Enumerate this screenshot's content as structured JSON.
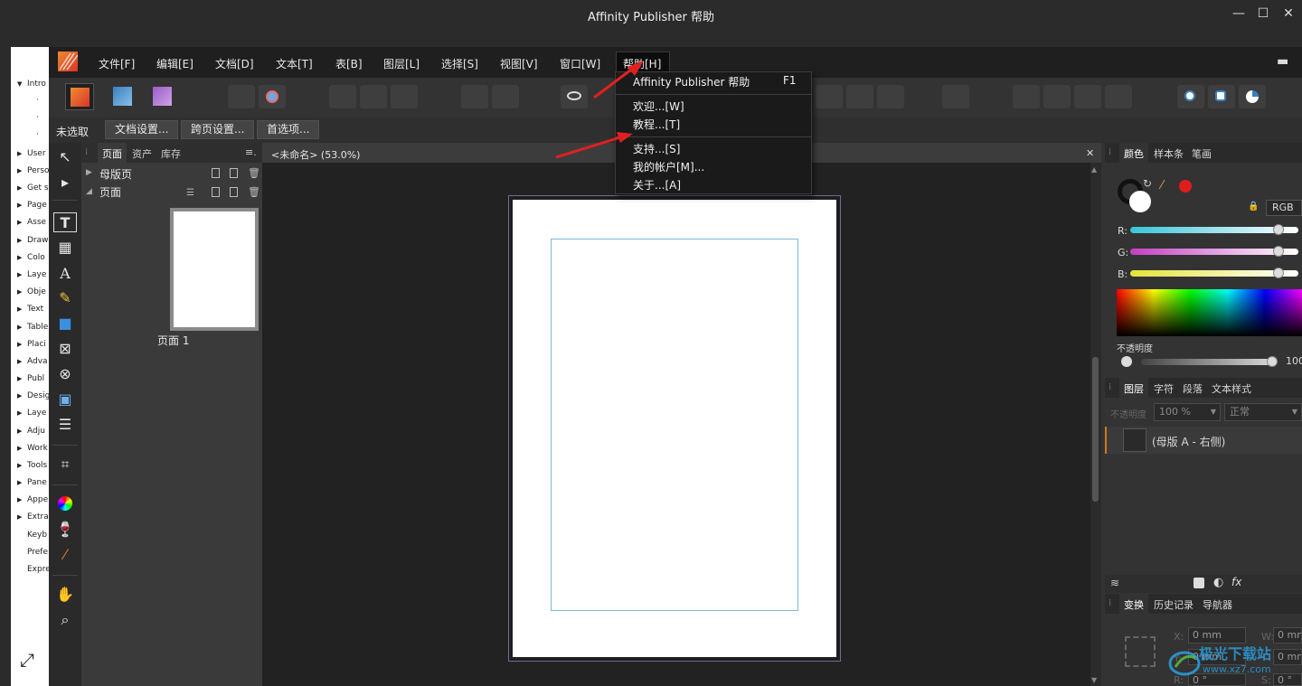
{
  "window": {
    "title": "Affinity Publisher 帮助",
    "controls": {
      "minimize": "—",
      "maximize": "☐",
      "close": "✕"
    }
  },
  "help_nav": {
    "back": "⇦",
    "forward": "⇨",
    "toc": [
      "Intro",
      "·",
      "·",
      "·",
      "User",
      "Perso",
      "Get s",
      "Page",
      "Asse",
      "Draw",
      "Colo",
      "Laye",
      "Obje",
      "Text",
      "Table",
      "Placi",
      "Adva",
      "Publ",
      "Desig",
      "Laye",
      "Adju",
      "Work",
      "Tools",
      "Pane",
      "Appe",
      "Extra",
      "Keyb",
      "Prefe",
      "Expre"
    ],
    "expand_icon": "⤢"
  },
  "menubar": {
    "items": [
      "文件[F]",
      "编辑[E]",
      "文档[D]",
      "文本[T]",
      "表[B]",
      "图层[L]",
      "选择[S]",
      "视图[V]",
      "窗口[W]",
      "帮助[H]"
    ]
  },
  "help_menu": {
    "items": [
      {
        "label": "Affinity Publisher 帮助",
        "shortcut": "F1"
      },
      {
        "label": "欢迎...[W]",
        "shortcut": ""
      },
      {
        "label": "教程...[T]",
        "shortcut": ""
      },
      {
        "label": "支持...[S]",
        "shortcut": ""
      },
      {
        "label": "我的帐户[M]...",
        "shortcut": ""
      },
      {
        "label": "关于...[A]",
        "shortcut": ""
      }
    ]
  },
  "context_bar": {
    "status": "未选取",
    "buttons": [
      "文档设置...",
      "跨页设置...",
      "首选项..."
    ]
  },
  "pages_panel": {
    "tabs": [
      "页面",
      "资产",
      "库存"
    ],
    "menu_icon": "≡.",
    "sections": [
      "母版页",
      "页面"
    ],
    "page_label": "页面 1"
  },
  "document": {
    "tab_title": "<未命名> (53.0%)",
    "close": "✕"
  },
  "color_panel": {
    "tabs": [
      "颜色",
      "样本条",
      "笔画"
    ],
    "model": "RGB",
    "channels": [
      "R:",
      "G:",
      "B:"
    ],
    "opacity_label": "不透明度",
    "opacity_value": "100",
    "channel_values": [
      1.0,
      1.0,
      1.0
    ]
  },
  "layers_panel": {
    "tabs": [
      "图层",
      "字符",
      "段落",
      "文本样式"
    ],
    "opacity_label": "不透明度",
    "opacity_value": "100 %",
    "blend_mode": "正常",
    "layer_name": "(母版 A - 右侧)"
  },
  "transform_panel": {
    "tabs": [
      "变换",
      "历史记录",
      "导航器"
    ],
    "x_label": "X:",
    "y_label": "Y:",
    "w_label": "W:",
    "r_label": "R:",
    "s_label": "S:",
    "x_value": "0 mm",
    "y_value": "0 mm",
    "w_value": "0 mm",
    "h_value": "0 mm",
    "r_value": "0 °",
    "s_value": "0 °"
  },
  "watermark": {
    "text": "极光下载站",
    "url_text": "www.xz7.com"
  },
  "colors": {
    "accent_arrow": "#e02020",
    "margin_guide": "#7cb8d8",
    "menu_bg": "#1a1a1a"
  }
}
